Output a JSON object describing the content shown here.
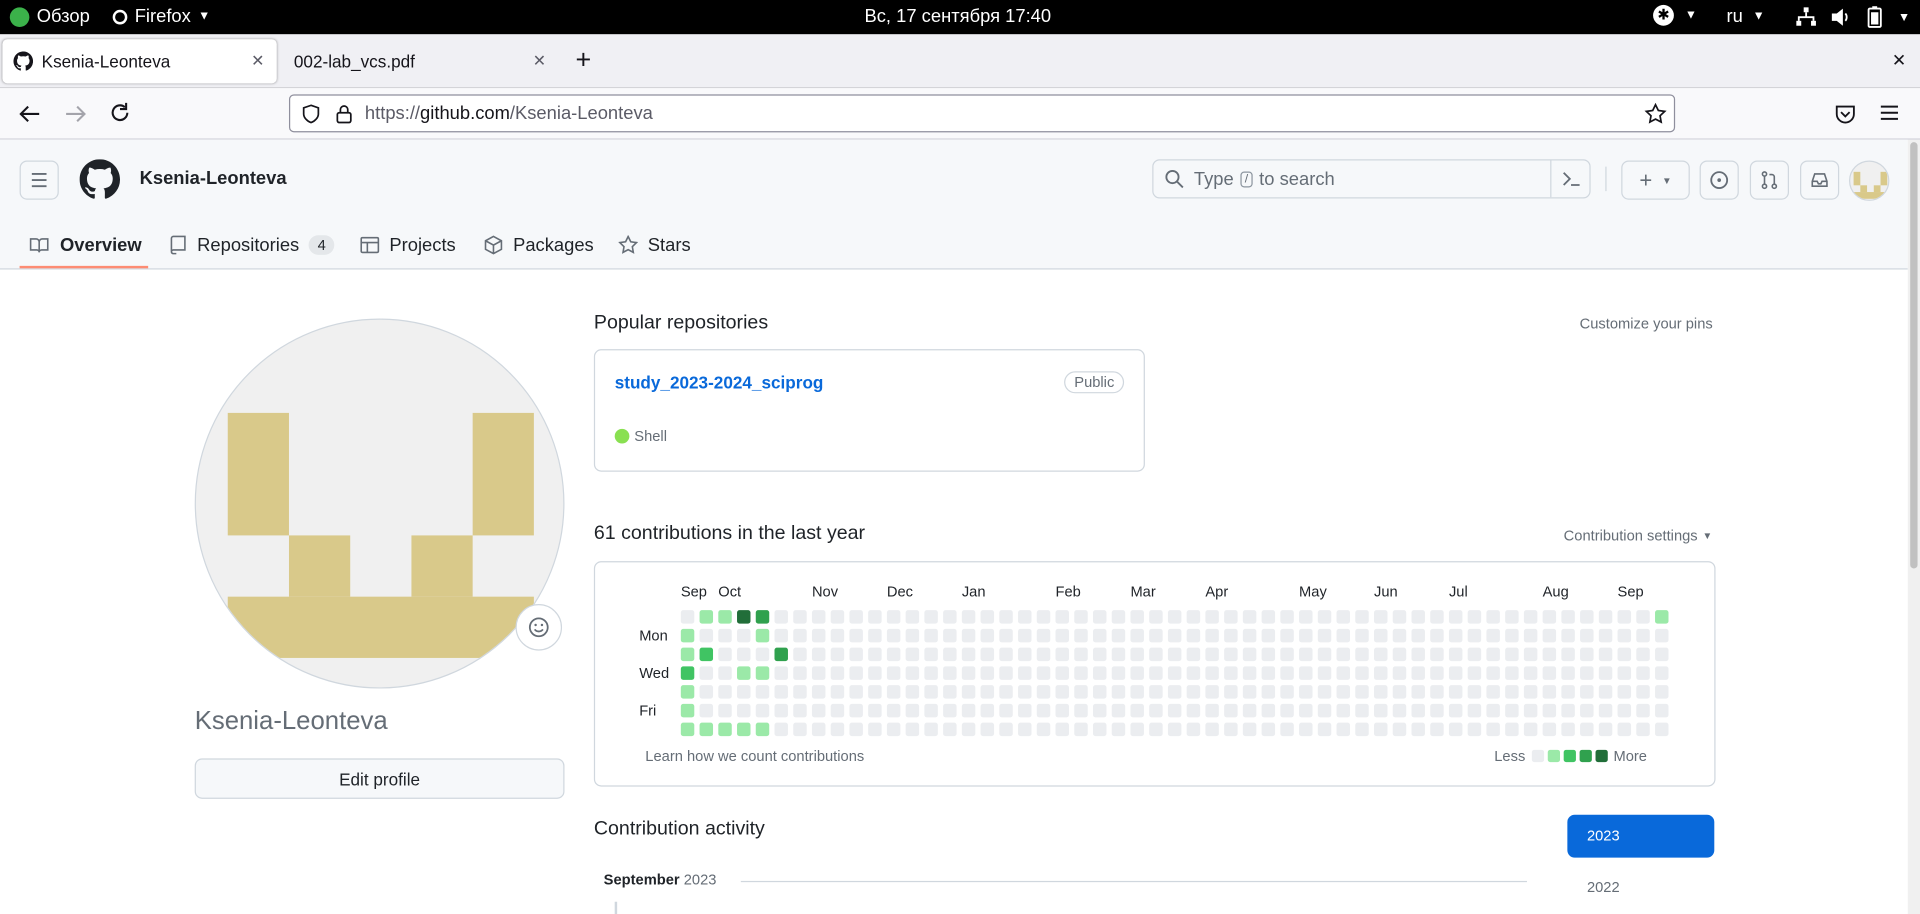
{
  "gnome": {
    "overview": "Обзор",
    "app": "Firefox",
    "clock": "Вс, 17 сентября  17:40",
    "lang": "ru"
  },
  "browser": {
    "tabs": [
      {
        "title": "Ksenia-Leonteva"
      },
      {
        "title": "002-lab_vcs.pdf"
      }
    ],
    "url_prefix": "https://",
    "url_domain": "github.com",
    "url_path": "/Ksenia-Leonteva"
  },
  "header": {
    "username": "Ksenia-Leonteva",
    "search_type": "Type",
    "search_key": "/",
    "search_rest": "to search"
  },
  "nav": {
    "overview": "Overview",
    "repositories": "Repositories",
    "repo_count": "4",
    "projects": "Projects",
    "packages": "Packages",
    "stars": "Stars"
  },
  "profile": {
    "name": "Ksenia-Leonteva",
    "edit_button": "Edit profile"
  },
  "popular": {
    "title": "Popular repositories",
    "customize": "Customize your pins",
    "repo": {
      "name": "study_2023-2024_sciprog",
      "visibility": "Public",
      "language": "Shell",
      "language_color": "#89e051"
    }
  },
  "contrib": {
    "title": "61 contributions in the last year",
    "settings": "Contribution settings",
    "months": [
      "Sep",
      "Oct",
      "Nov",
      "Dec",
      "Jan",
      "Feb",
      "Mar",
      "Apr",
      "May",
      "Jun",
      "Jul",
      "Aug",
      "Sep"
    ],
    "days": [
      "Mon",
      "Wed",
      "Fri"
    ],
    "learn": "Learn how we count contributions",
    "less": "Less",
    "more": "More",
    "colors": [
      "#ebedf0",
      "#9be9a8",
      "#40c463",
      "#30a14e",
      "#216e39"
    ],
    "cells": [
      [
        0,
        1
      ],
      [
        0,
        2
      ],
      [
        0,
        3
      ],
      [
        0,
        4
      ],
      [
        0,
        5
      ],
      [
        0,
        6
      ],
      [
        0,
        1
      ],
      [
        52,
        0
      ],
      [
        1,
        0
      ],
      [
        1,
        2
      ],
      [
        1,
        6
      ],
      [
        2,
        0
      ],
      [
        2,
        6
      ],
      [
        3,
        0
      ],
      [
        3,
        3
      ],
      [
        3,
        6
      ],
      [
        4,
        0
      ],
      [
        4,
        1
      ],
      [
        4,
        3
      ],
      [
        4,
        6
      ],
      [
        5,
        2
      ]
    ],
    "cell_levels": [
      2,
      1,
      2,
      1,
      1,
      1,
      1,
      1,
      1,
      2,
      1,
      1,
      1,
      4,
      1,
      1,
      3,
      1,
      1,
      1,
      3
    ]
  },
  "activity": {
    "title": "Contribution activity",
    "month": "September",
    "year": "2023",
    "years": [
      "2023",
      "2022"
    ]
  }
}
